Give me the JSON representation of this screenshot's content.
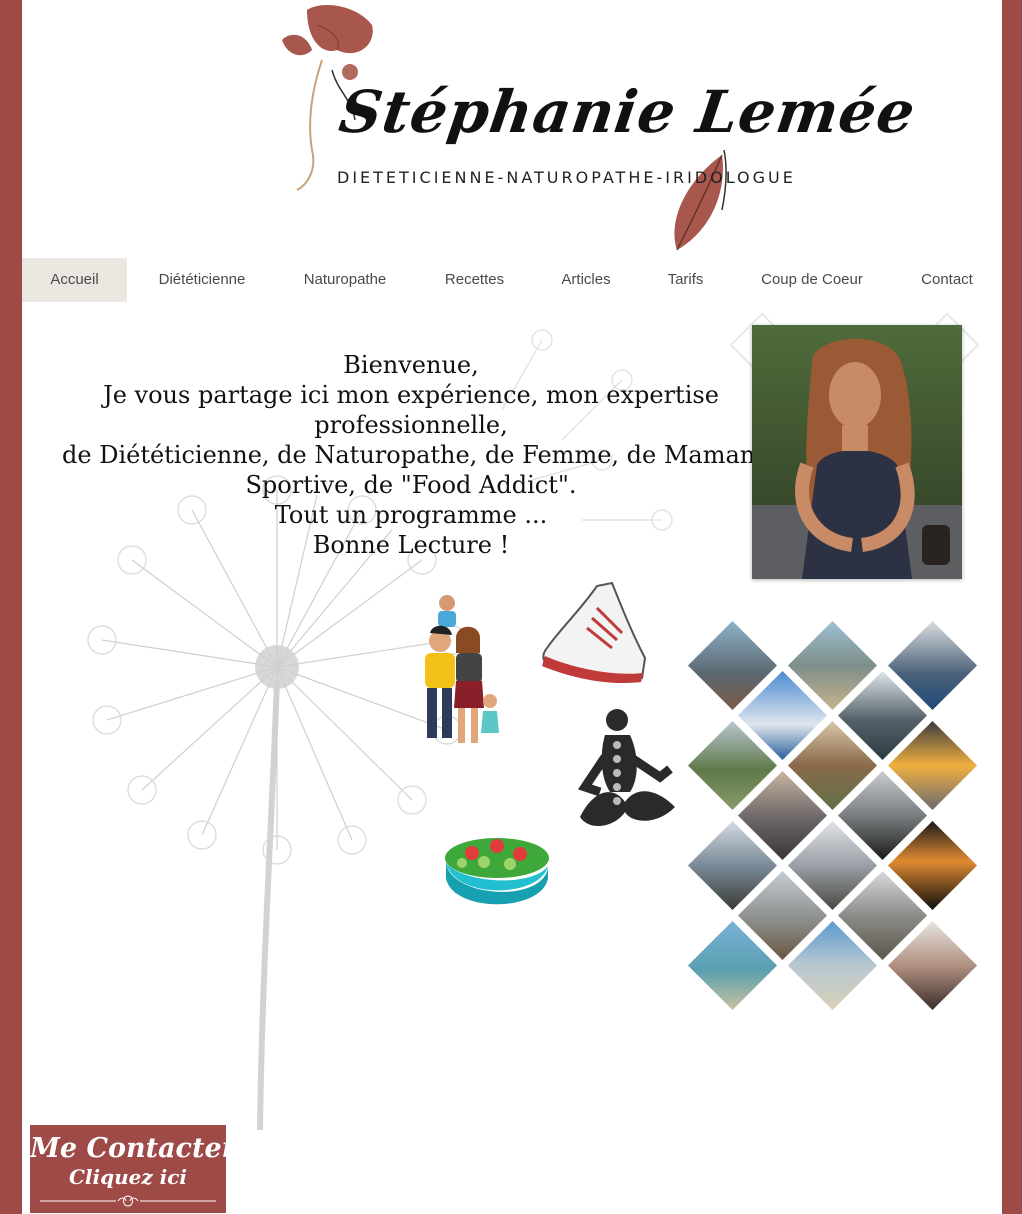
{
  "brand": {
    "name": "Stéphanie Lemée",
    "tagline": "DIETETICIENNE-NATUROPATHE-IRIDOLOGUE",
    "accent_color": "#9e4a47"
  },
  "nav": {
    "items": [
      {
        "label": "Accueil",
        "active": true
      },
      {
        "label": "Diététicienne"
      },
      {
        "label": "Naturopathe"
      },
      {
        "label": "Recettes"
      },
      {
        "label": "Articles"
      },
      {
        "label": "Tarifs"
      },
      {
        "label": "Coup de Coeur"
      },
      {
        "label": "Contact"
      }
    ]
  },
  "welcome": {
    "lines": [
      "Bienvenue,",
      "Je vous partage ici mon expérience, mon expertise",
      "professionnelle,",
      "de Diététicienne, de Naturopathe, de Femme, de Maman, de",
      "Sportive, de \"Food Addict\".",
      "Tout un programme ...",
      "Bonne Lecture !"
    ]
  },
  "cta": {
    "line1": "Me Contacter ?",
    "line2": "Cliquez ici"
  }
}
